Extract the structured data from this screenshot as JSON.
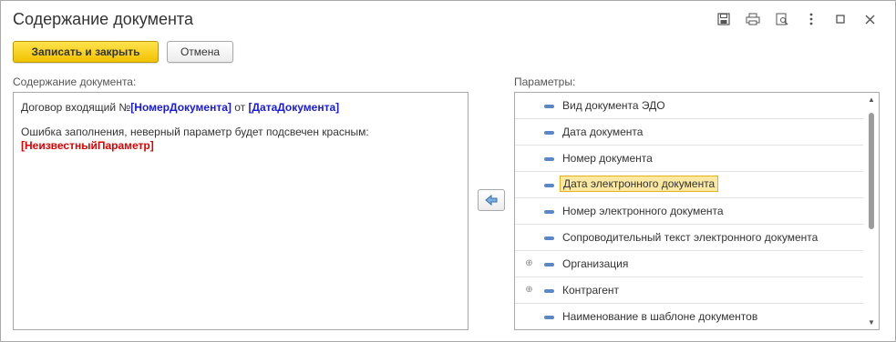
{
  "window": {
    "title": "Содержание документа"
  },
  "toolbar": {
    "save_close_label": "Записать и закрыть",
    "cancel_label": "Отмена"
  },
  "labels": {
    "content": "Содержание документа:",
    "params": "Параметры:"
  },
  "content": {
    "line1_prefix": "Договор входящий №",
    "line1_param1": "[НомерДокумента]",
    "line1_mid": " от ",
    "line1_param2": "[ДатаДокумента]",
    "line2": "Ошибка заполнения, неверный параметр будет подсвечен красным:",
    "line3_param": "[НеизвестныйПараметр]"
  },
  "params": {
    "items": [
      {
        "label": "Вид документа ЭДО",
        "expandable": false,
        "selected": false
      },
      {
        "label": "Дата документа",
        "expandable": false,
        "selected": false
      },
      {
        "label": "Номер документа",
        "expandable": false,
        "selected": false
      },
      {
        "label": "Дата электронного документа",
        "expandable": false,
        "selected": true
      },
      {
        "label": "Номер электронного документа",
        "expandable": false,
        "selected": false
      },
      {
        "label": "Сопроводительный текст электронного документа",
        "expandable": false,
        "selected": false
      },
      {
        "label": "Организация",
        "expandable": true,
        "selected": false
      },
      {
        "label": "Контрагент",
        "expandable": true,
        "selected": false
      },
      {
        "label": "Наименование в шаблоне документов",
        "expandable": false,
        "selected": false
      }
    ]
  },
  "colors": {
    "primary_button": "#f2c200",
    "param_valid": "#1a1adb",
    "param_invalid": "#e00000",
    "selection": "#fbe9a3"
  }
}
